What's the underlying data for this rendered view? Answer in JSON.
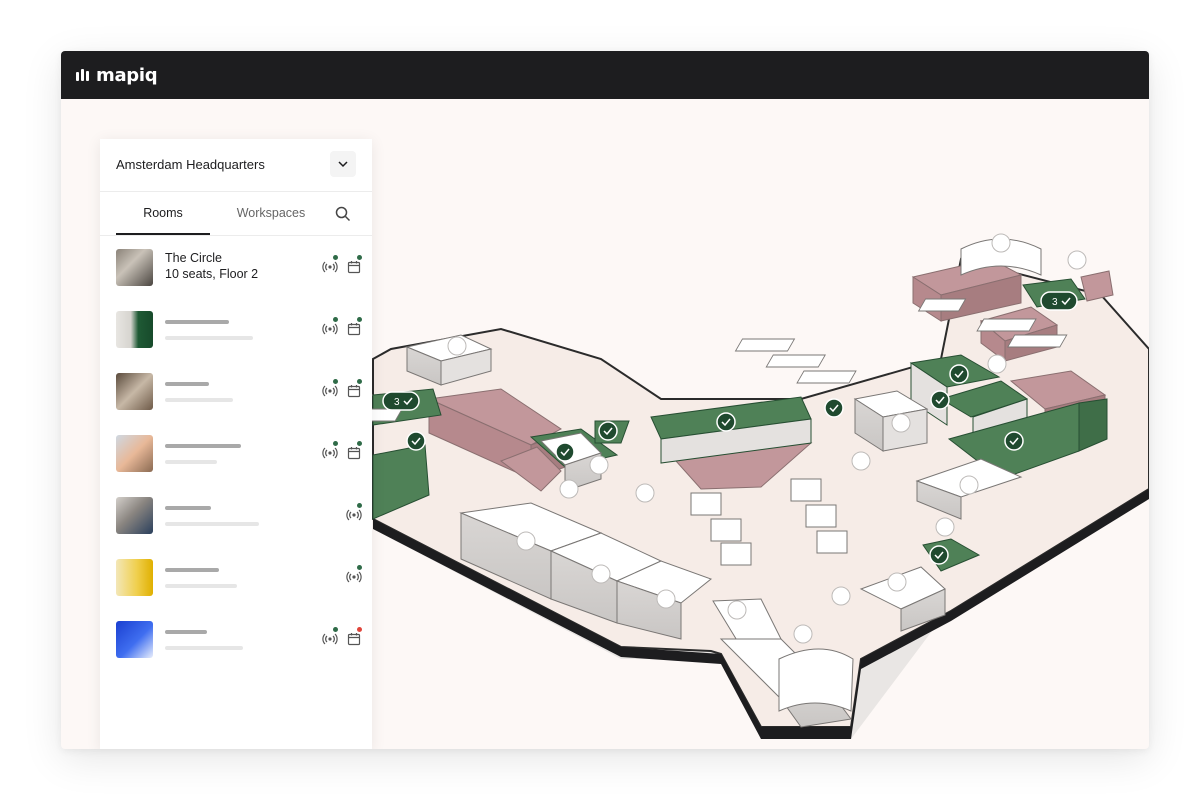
{
  "app": {
    "brand": "mapiq"
  },
  "location": {
    "name": "Amsterdam Headquarters"
  },
  "tabs": [
    {
      "label": "Rooms",
      "active": true
    },
    {
      "label": "Workspaces",
      "active": false
    }
  ],
  "rooms": [
    {
      "title": "The Circle",
      "subtitle": "10 seats, Floor 2",
      "sensor_status": "available",
      "calendar_status": "available"
    },
    {
      "title": "",
      "subtitle": "",
      "sensor_status": "available",
      "calendar_status": "available"
    },
    {
      "title": "",
      "subtitle": "",
      "sensor_status": "available",
      "calendar_status": "available"
    },
    {
      "title": "",
      "subtitle": "",
      "sensor_status": "available",
      "calendar_status": "available"
    },
    {
      "title": "",
      "subtitle": "",
      "sensor_status": "available",
      "calendar_status": ""
    },
    {
      "title": "",
      "subtitle": "",
      "sensor_status": "available",
      "calendar_status": ""
    },
    {
      "title": "",
      "subtitle": "",
      "sensor_status": "available",
      "calendar_status": "occupied"
    }
  ],
  "map_badges": [
    {
      "count": "3"
    },
    {
      "count": "3"
    }
  ],
  "colors": {
    "available": "#2f6b48",
    "occupied": "#e0443a",
    "room_available": "#4f8157",
    "room_booked": "#c2979b",
    "topbar": "#1d1d1f",
    "floor": "#f6ece7"
  }
}
